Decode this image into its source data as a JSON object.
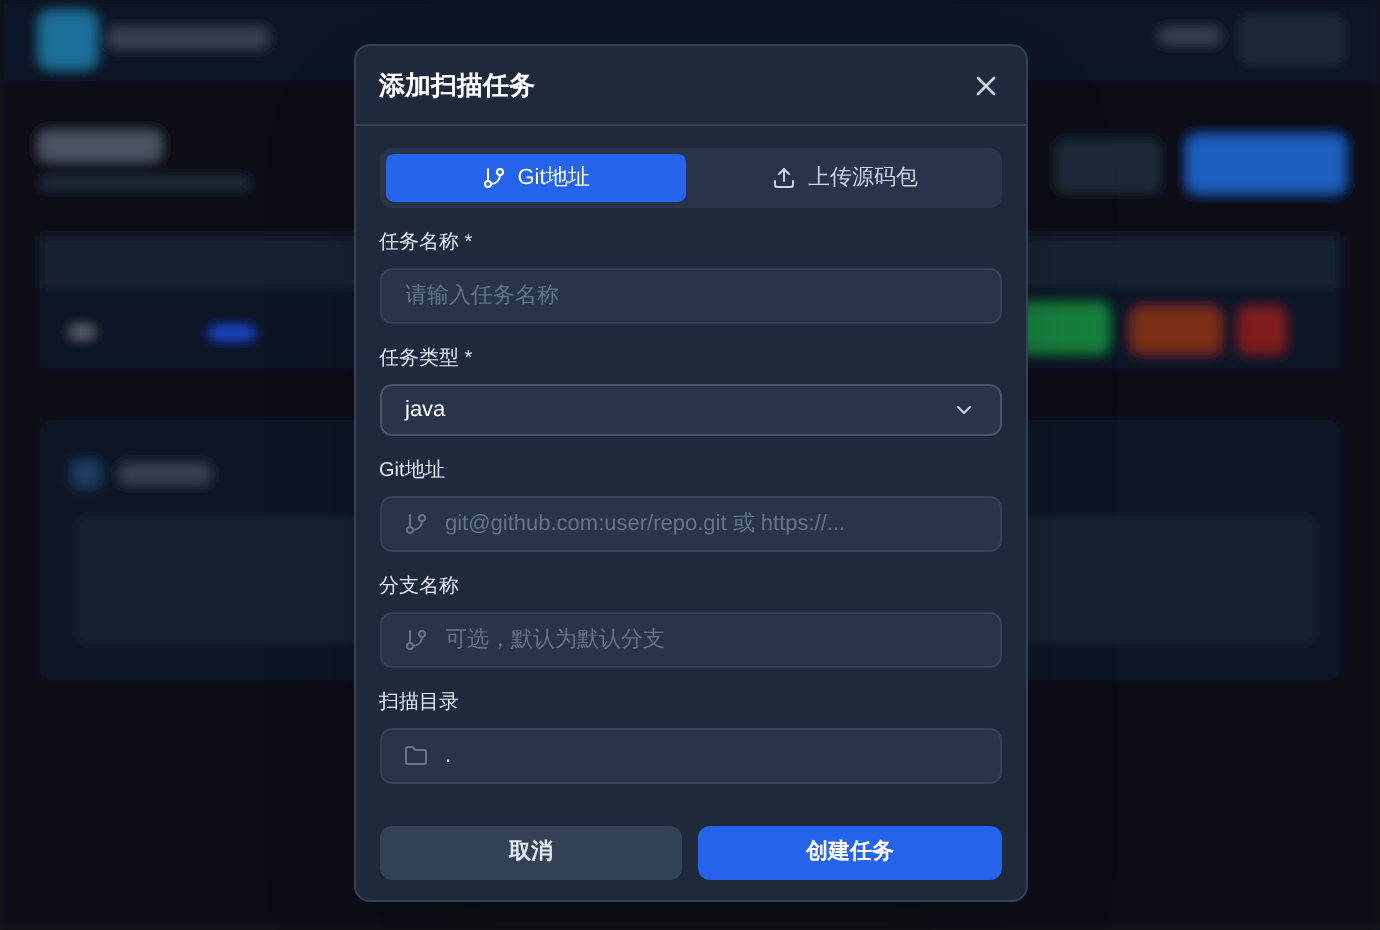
{
  "dialog": {
    "title": "添加扫描任务",
    "tabs": [
      {
        "label": "Git地址",
        "selected": true
      },
      {
        "label": "上传源码包",
        "selected": false
      }
    ],
    "fields": [
      {
        "kind": "text",
        "label": "任务名称 *",
        "placeholder": "请输入任务名称"
      },
      {
        "kind": "select",
        "label": "任务类型 *",
        "value": "java"
      },
      {
        "kind": "branch",
        "label": "Git地址",
        "placeholder": "git@github.com:user/repo.git 或 https://..."
      },
      {
        "kind": "branch",
        "label": "分支名称",
        "placeholder": "可选，默认为默认分支"
      },
      {
        "kind": "folder",
        "label": "扫描目录",
        "value": "."
      }
    ],
    "buttons": [
      {
        "label": "取消",
        "kind": "secondary"
      },
      {
        "label": "创建任务",
        "kind": "primary"
      }
    ]
  }
}
